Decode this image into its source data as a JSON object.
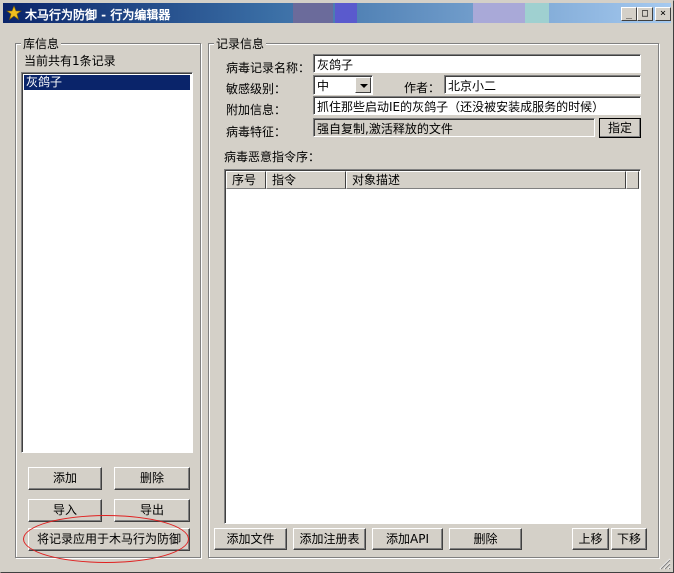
{
  "window": {
    "title": "木马行为防御 - 行为编辑器",
    "minimize_glyph": "_",
    "maximize_glyph": "□",
    "close_glyph": "×",
    "icon": "star-trojan-icon"
  },
  "library": {
    "group_title": "库信息",
    "count_text": "当前共有1条记录",
    "records": [
      "灰鸽子"
    ],
    "selected_index": 0,
    "buttons": {
      "add": "添加",
      "delete": "删除",
      "import": "导入",
      "export": "导出",
      "apply": "将记录应用于木马行为防御"
    }
  },
  "record": {
    "group_title": "记录信息",
    "name_label": "病毒记录名称：",
    "name_value": "灰鸽子",
    "level_label": "敏感级别：",
    "level_value": "中",
    "author_label": "作者：",
    "author_value": "北京小二",
    "extra_label": "附加信息：",
    "extra_value": "抓住那些启动IE的灰鸽子（还没被安装成服务的时候）",
    "feature_label": "病毒特征：",
    "feature_value": "强自复制,激活释放的文件",
    "specify_button": "指定",
    "sequence_label": "病毒恶意指令序：",
    "columns": [
      "序号",
      "指令",
      "对象描述"
    ],
    "rows": [],
    "buttons": {
      "add_file": "添加文件",
      "add_registry": "添加注册表",
      "add_api": "添加API",
      "delete": "删除",
      "move_up": "上移",
      "move_down": "下移"
    }
  },
  "colors": {
    "face": "#d4d0c8",
    "title_start": "#0a246a",
    "title_end": "#a6caf0",
    "selection": "#0a246a",
    "annotation": "#e02020"
  }
}
